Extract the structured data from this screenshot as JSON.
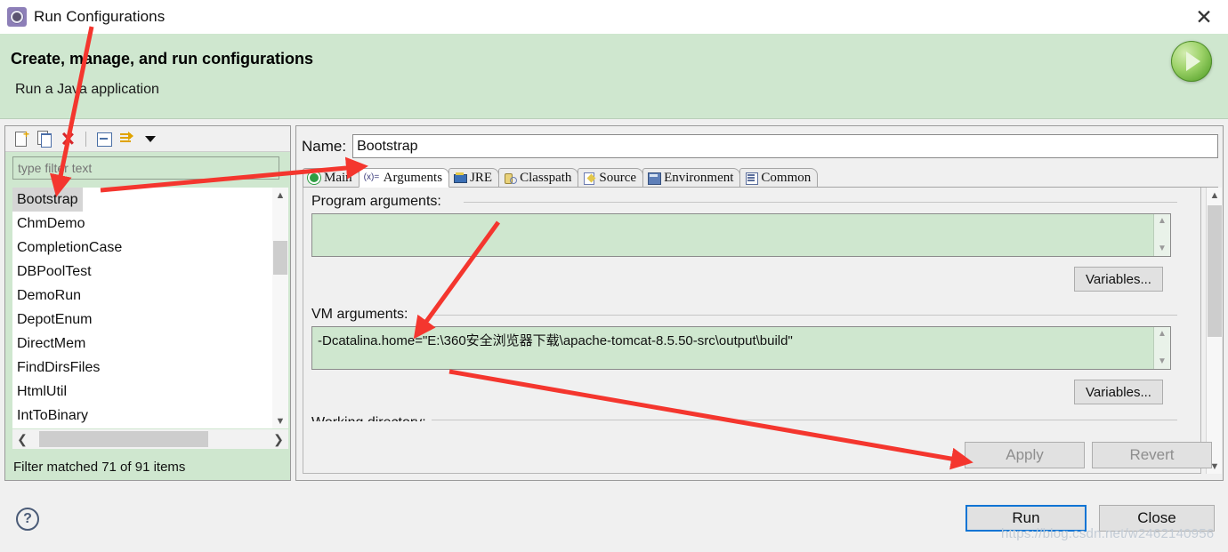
{
  "window": {
    "title": "Run Configurations",
    "title_icon": "gear-icon",
    "close_icon": "✕"
  },
  "banner": {
    "title": "Create, manage, and run configurations",
    "subtitle": "Run a Java application",
    "icon": "run-play-icon"
  },
  "left_panel": {
    "toolbar": [
      {
        "name": "new-configuration-icon",
        "title": "New launch configuration"
      },
      {
        "name": "duplicate-configuration-icon",
        "title": "Duplicate"
      },
      {
        "name": "delete-configuration-icon",
        "title": "Delete"
      },
      {
        "name": "collapse-all-icon",
        "title": "Collapse All"
      },
      {
        "name": "filter-icon",
        "title": "Filter"
      },
      {
        "name": "dropdown-arrow-icon",
        "title": "View Menu"
      }
    ],
    "filter_value": "",
    "filter_placeholder": "type filter text",
    "items": [
      "Bootstrap",
      "ChmDemo",
      "CompletionCase",
      "DBPoolTest",
      "DemoRun",
      "DepotEnum",
      "DirectMem",
      "FindDirsFiles",
      "HtmlUtil",
      "IntToBinary"
    ],
    "selected_item": "Bootstrap",
    "status": "Filter matched 71 of 91 items",
    "scroll_up_icon": "chevron-up-icon",
    "scroll_down_icon": "chevron-down-icon",
    "scroll_left_icon": "chevron-left-icon",
    "scroll_right_icon": "chevron-right-icon"
  },
  "right_panel": {
    "name_label": "Name:",
    "name_value": "Bootstrap",
    "tabs": [
      {
        "label": "Main",
        "icon": "java-main-icon",
        "active": false
      },
      {
        "label": "Arguments",
        "icon": "arguments-icon",
        "active": true
      },
      {
        "label": "JRE",
        "icon": "jre-icon",
        "active": false
      },
      {
        "label": "Classpath",
        "icon": "classpath-icon",
        "active": false
      },
      {
        "label": "Source",
        "icon": "source-icon",
        "active": false
      },
      {
        "label": "Environment",
        "icon": "environment-icon",
        "active": false
      },
      {
        "label": "Common",
        "icon": "common-icon",
        "active": false
      }
    ],
    "arguments_tab": {
      "program_arguments_label": "Program arguments:",
      "program_arguments_value": "",
      "program_variables_button": "Variables...",
      "vm_arguments_label": "VM arguments:",
      "vm_arguments_value": "-Dcatalina.home=\"E:\\360安全浏览器下载\\apache-tomcat-8.5.50-src\\output\\build\"",
      "vm_variables_button": "Variables...",
      "partial_next_section_label": "Working directory:",
      "spin_up_icon": "chevron-up-icon",
      "spin_down_icon": "chevron-down-icon"
    }
  },
  "footer": {
    "apply_label": "Apply",
    "apply_enabled": false,
    "revert_label": "Revert",
    "revert_enabled": false,
    "run_label": "Run",
    "close_label": "Close",
    "help_icon": "?"
  },
  "watermark": "https://blog.csdn.net/w2462140956",
  "colors": {
    "banner_green": "#cfe7cf",
    "field_green": "#cfe7cf",
    "accent_blue": "#0c74d4",
    "annotation_red": "#f4362e",
    "dialog_gray": "#f0f0f0"
  }
}
